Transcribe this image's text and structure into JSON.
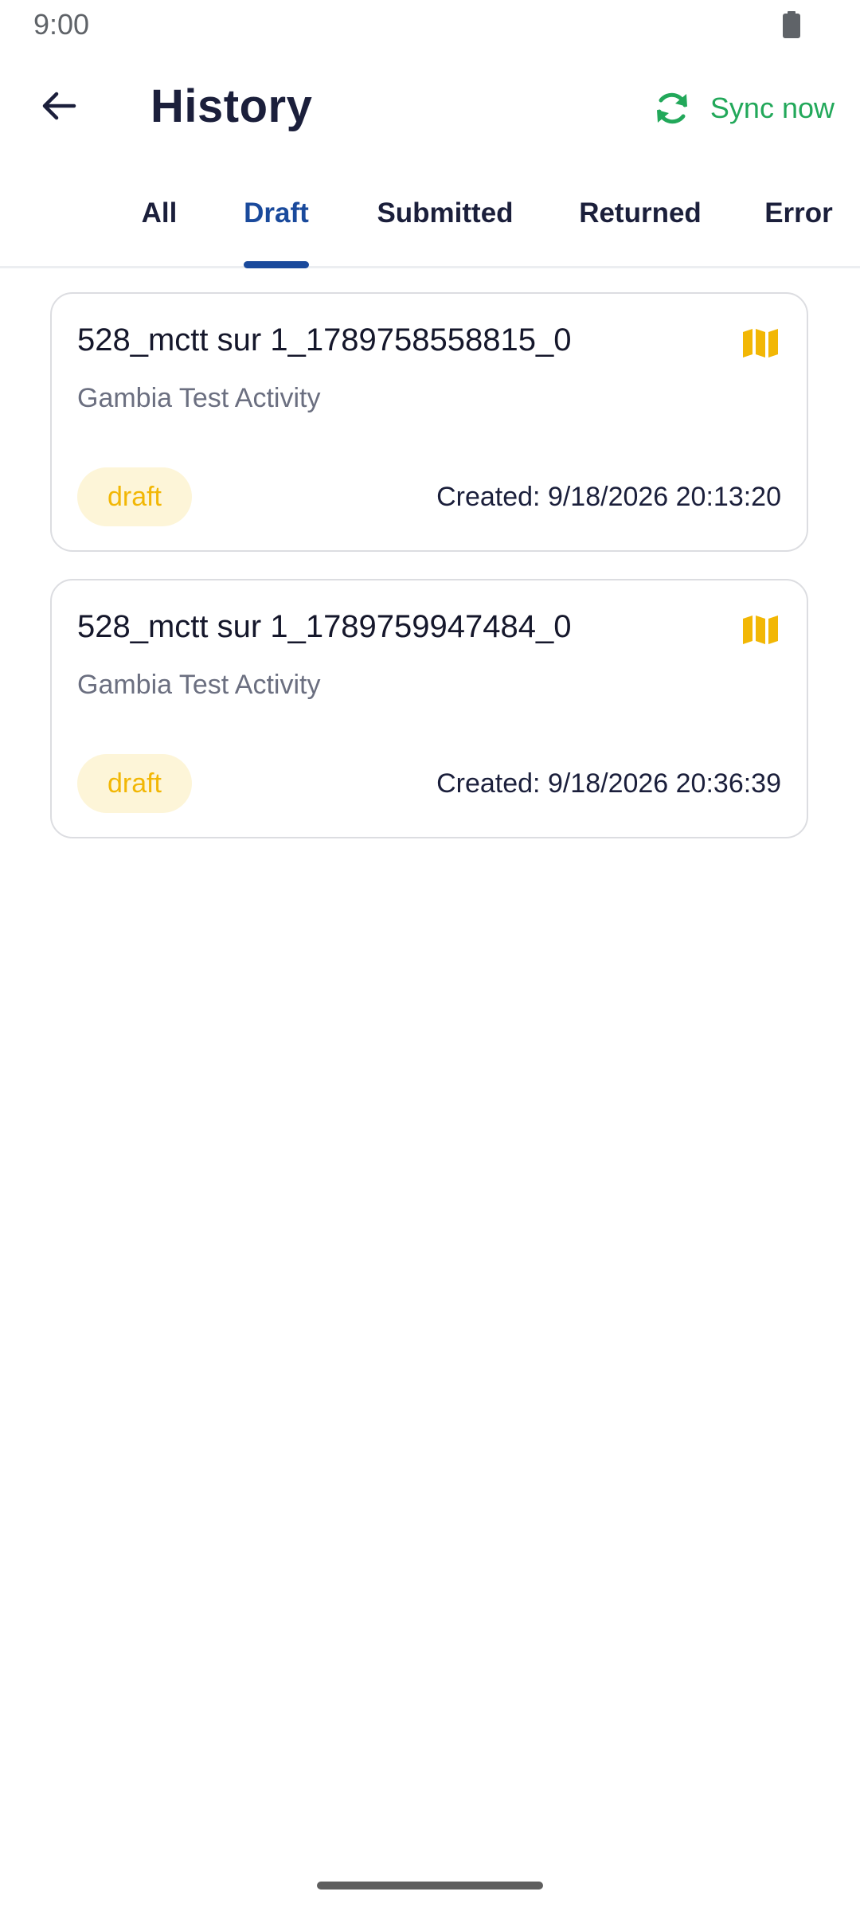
{
  "status_bar": {
    "time": "9:00"
  },
  "header": {
    "title": "History",
    "sync_label": "Sync now"
  },
  "tabs": [
    {
      "label": "All",
      "active": false
    },
    {
      "label": "Draft",
      "active": true
    },
    {
      "label": "Submitted",
      "active": false
    },
    {
      "label": "Returned",
      "active": false
    },
    {
      "label": "Error",
      "active": false
    }
  ],
  "records": [
    {
      "title": "528_mctt sur 1_1789758558815_0",
      "activity": "Gambia Test Activity",
      "status": "draft",
      "created": "Created: 9/18/2026 20:13:20"
    },
    {
      "title": "528_mctt sur 1_1789759947484_0",
      "activity": "Gambia Test Activity",
      "status": "draft",
      "created": "Created: 9/18/2026 20:36:39"
    }
  ],
  "colors": {
    "accent": "#1a4a9c",
    "sync_green": "#22a85a",
    "draft_yellow": "#f2b705",
    "draft_badge_bg": "#fdf5d8",
    "title_text": "#1b1f3b"
  },
  "icons": {
    "back": "arrow-left-icon",
    "sync": "refresh-icon",
    "record_type": "map-icon",
    "battery": "battery-icon"
  }
}
